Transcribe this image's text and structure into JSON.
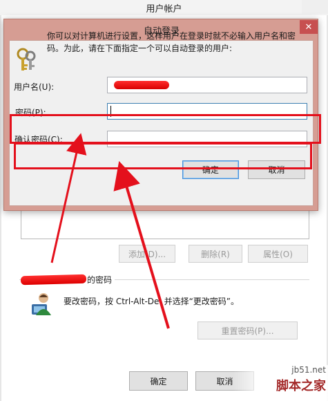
{
  "background_window": {
    "title": "用户帐户",
    "buttons": {
      "add": "添加(D)...",
      "delete": "删除(R)",
      "properties": "属性(O)",
      "reset_password": "重置密码(P)...",
      "ok": "确定",
      "cancel": "取消"
    },
    "password_group": {
      "label_visible_suffix": "的密码",
      "hint": "要改密码，按 Ctrl-Alt-Del 并选择“更改密码”。"
    }
  },
  "dialog": {
    "title": "自动登录",
    "close_glyph": "✕",
    "description": "你可以对计算机进行设置，这样用户在登录时就不必输入用户名和密码。为此，请在下面指定一个可以自动登录的用户:",
    "fields": {
      "username_label": "用户名(U):",
      "password_label": "密码(P):",
      "confirm_label": "确认密码(C):",
      "username_value": "",
      "password_value": "",
      "confirm_value": ""
    },
    "buttons": {
      "ok": "确定",
      "cancel": "取消"
    }
  },
  "watermark": {
    "url": "jb51.net",
    "name": "脚本之家"
  },
  "colors": {
    "annotation_red": "#e4101c",
    "dialog_frame": "#d69d93",
    "close_button": "#c75050",
    "focus_border": "#3c7fb1"
  },
  "icons": [
    "keys-icon",
    "user-avatar-icon",
    "close-icon"
  ]
}
